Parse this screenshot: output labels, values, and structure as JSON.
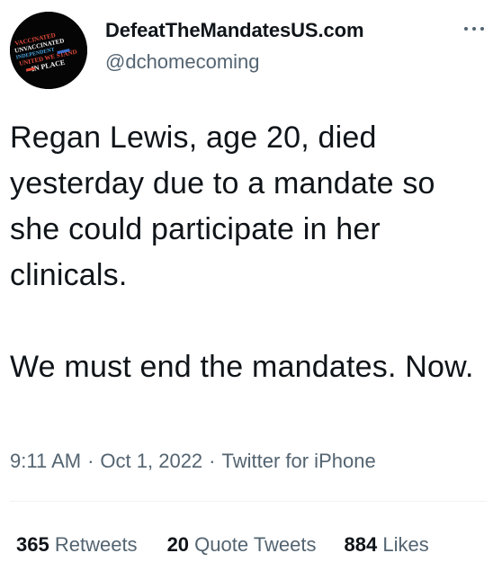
{
  "author": {
    "display_name": "DefeatTheMandatesUS.com",
    "handle": "@dchomecoming",
    "avatar_lines": [
      "VACCINATED",
      "UNVACCINATED",
      "INDEPENDENT",
      "UNITED WE STAND",
      "IN PLACE"
    ]
  },
  "menu_icon": "more-horizontal-icon",
  "tweet": {
    "paragraph1": "Regan Lewis, age 20, died yesterday due to a mandate so she could participate in her clinicals.",
    "paragraph2": "We must end the mandates. Now."
  },
  "meta": {
    "time": "9:11 AM",
    "date": "Oct 1, 2022",
    "source": "Twitter for iPhone",
    "separator": "·"
  },
  "stats": {
    "retweets_count": "365",
    "retweets_label": "Retweets",
    "quotes_count": "20",
    "quotes_label": "Quote Tweets",
    "likes_count": "884",
    "likes_label": "Likes"
  },
  "colors": {
    "text_primary": "#0f1419",
    "text_secondary": "#536471",
    "divider": "#eff3f4",
    "avatar_bg": "#050505"
  }
}
